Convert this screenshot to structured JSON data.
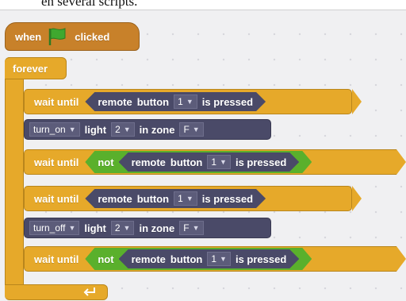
{
  "caption": "en several scripts.",
  "hat": {
    "when": "when",
    "clicked": "clicked",
    "flag_color": "#3fa82f"
  },
  "forever": {
    "label": "forever"
  },
  "blocks": [
    {
      "wait_label": "wait until",
      "remote": "remote",
      "button": "button",
      "value": "1",
      "is_pressed": "is pressed"
    },
    {
      "action": "turn_on",
      "light": "light",
      "light_value": "2",
      "in_zone": "in zone",
      "zone": "F"
    },
    {
      "wait_label": "wait until",
      "not": "not",
      "remote": "remote",
      "button": "button",
      "value": "1",
      "is_pressed": "is pressed"
    },
    {
      "wait_label": "wait until",
      "remote": "remote",
      "button": "button",
      "value": "1",
      "is_pressed": "is pressed"
    },
    {
      "action": "turn_off",
      "light": "light",
      "light_value": "2",
      "in_zone": "in zone",
      "zone": "F"
    },
    {
      "wait_label": "wait until",
      "not": "not",
      "remote": "remote",
      "button": "button",
      "value": "1",
      "is_pressed": "is pressed"
    }
  ],
  "colors": {
    "events": "#c8812a",
    "control": "#e6a92a",
    "sensing": "#4a4a68",
    "operators": "#5ab02c"
  },
  "icons": {
    "flag": "green-flag-icon",
    "loop": "loop-arrow-icon",
    "dropdown": "dropdown-arrow-icon"
  }
}
